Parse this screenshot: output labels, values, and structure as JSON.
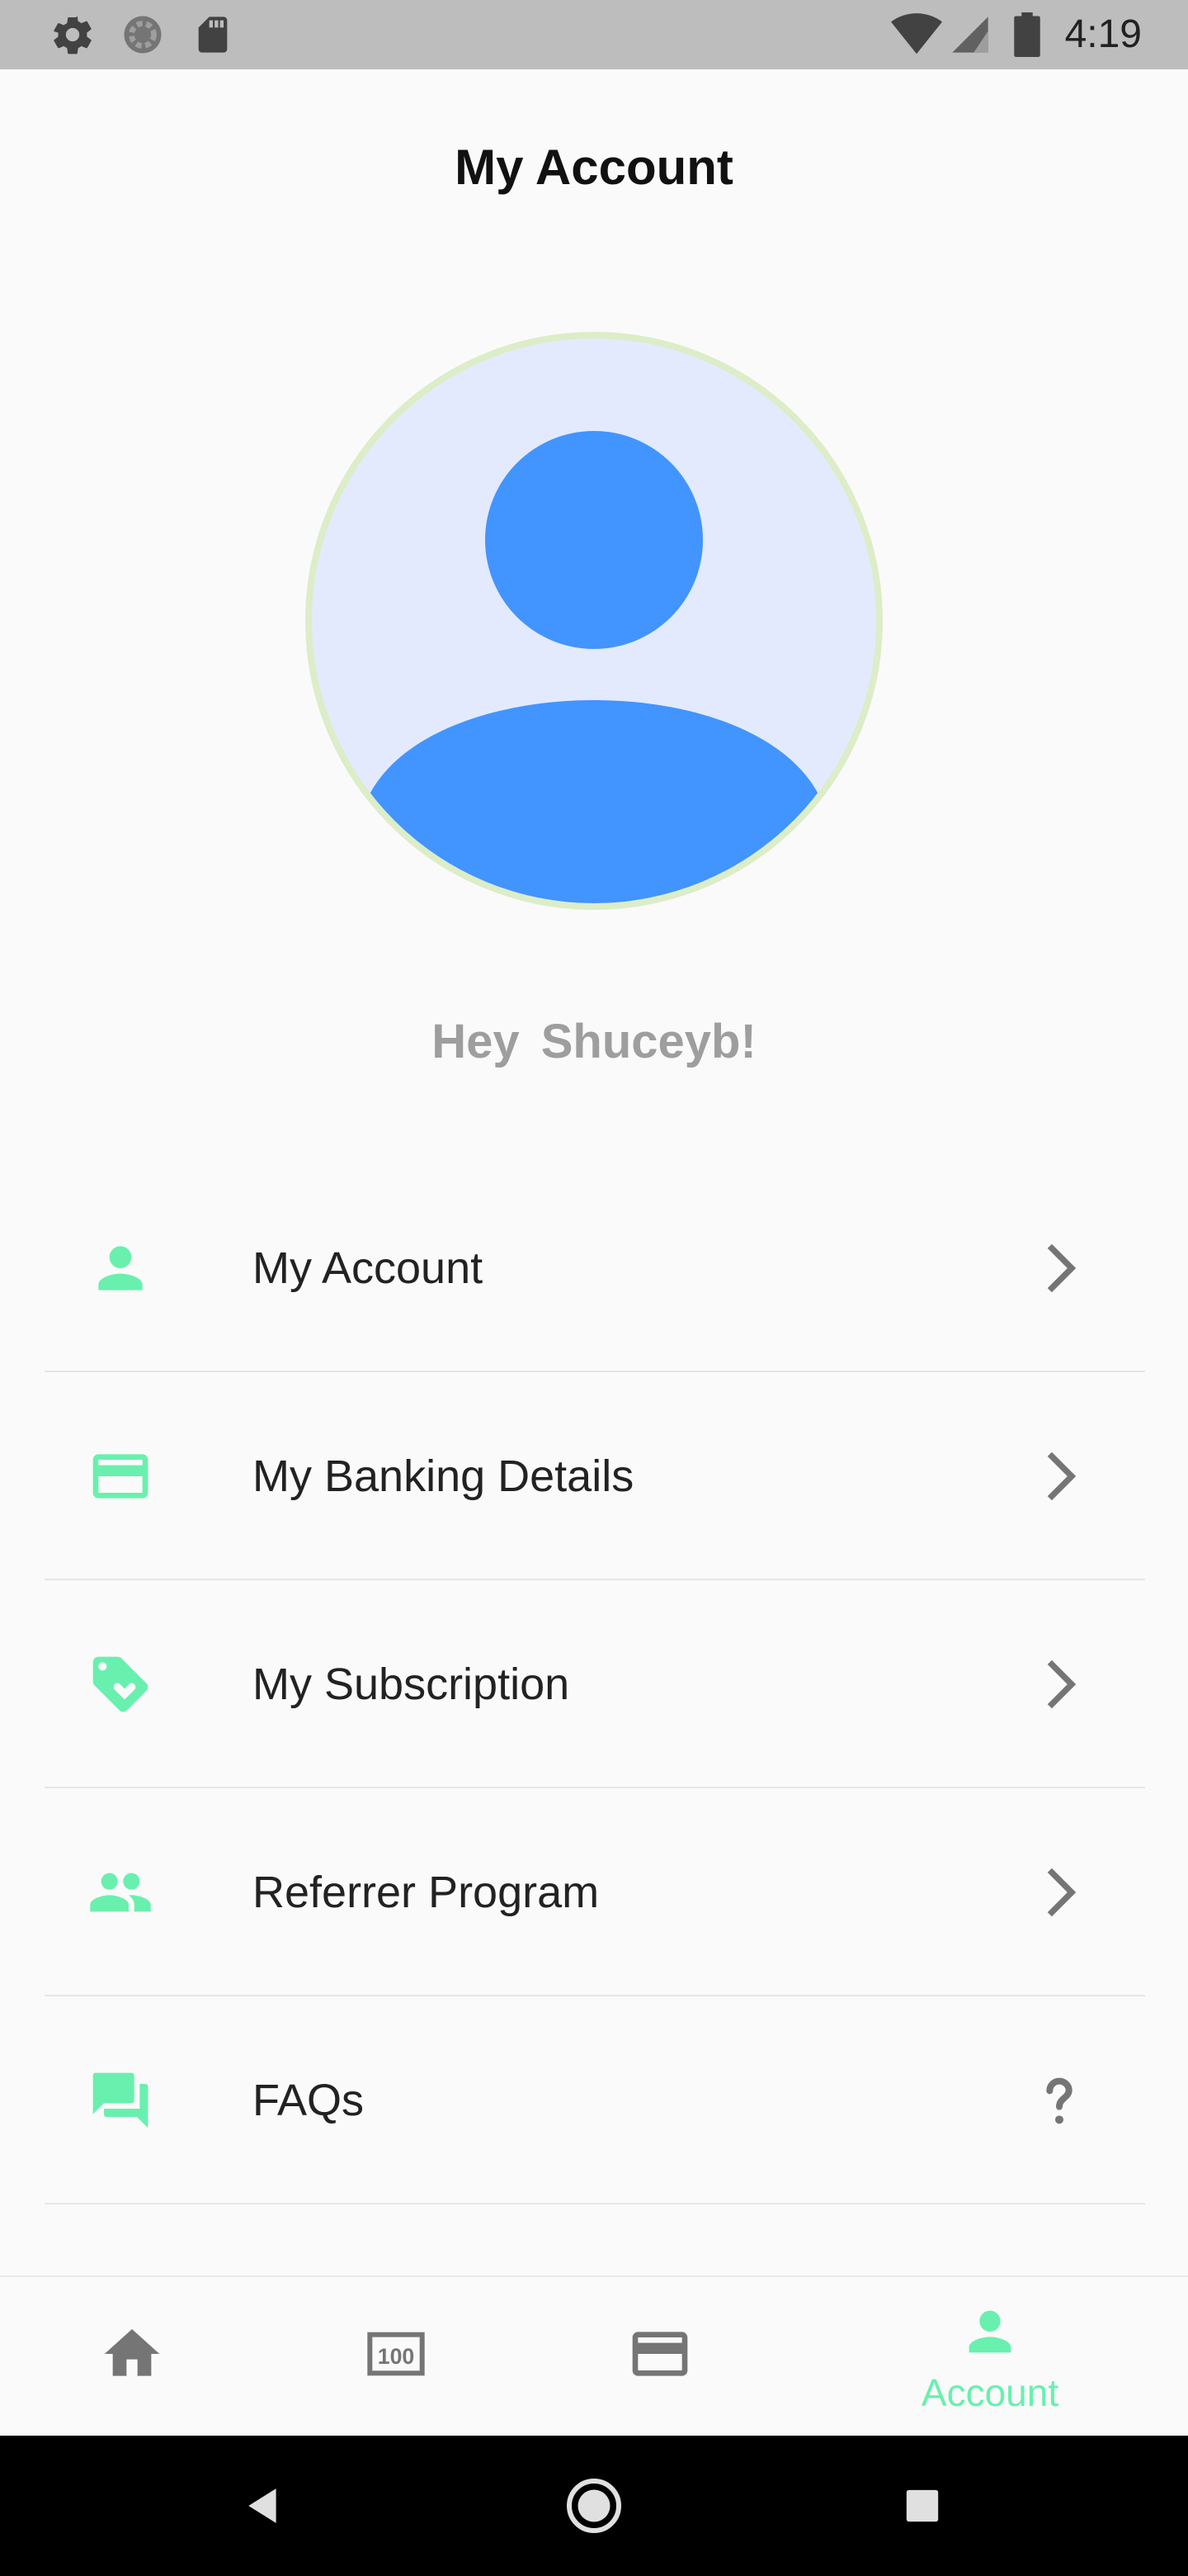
{
  "status_bar": {
    "time": "4:19",
    "left_icons": [
      "gear-icon",
      "sync-icon",
      "sd-card-icon"
    ],
    "right_icons": [
      "wifi-icon",
      "signal-icon",
      "battery-icon"
    ]
  },
  "header": {
    "title": "My Account"
  },
  "profile": {
    "greeting": "Hey  Shuceyb!"
  },
  "menu": {
    "items": [
      {
        "label": "My Account",
        "icon": "person-icon",
        "trailing": "chevron-right-icon"
      },
      {
        "label": "My Banking Details",
        "icon": "credit-card-icon",
        "trailing": "chevron-right-icon"
      },
      {
        "label": "My Subscription",
        "icon": "tag-heart-icon",
        "trailing": "chevron-right-icon"
      },
      {
        "label": "Referrer Program",
        "icon": "people-icon",
        "trailing": "chevron-right-icon"
      },
      {
        "label": "FAQs",
        "icon": "chat-icon",
        "trailing": "question-icon"
      }
    ]
  },
  "bottom_nav": {
    "items": [
      {
        "icon": "home-icon",
        "label": ""
      },
      {
        "icon": "voucher-icon",
        "label": ""
      },
      {
        "icon": "card-icon",
        "label": ""
      },
      {
        "icon": "account-icon",
        "label": "Account",
        "active": true
      }
    ]
  },
  "colors": {
    "accent": "#69f0ae",
    "avatar_blue": "#4294ff",
    "avatar_bg": "#e3eafd",
    "greeting_gray": "#9e9e9e",
    "status_bar": "#bdbdbd"
  }
}
